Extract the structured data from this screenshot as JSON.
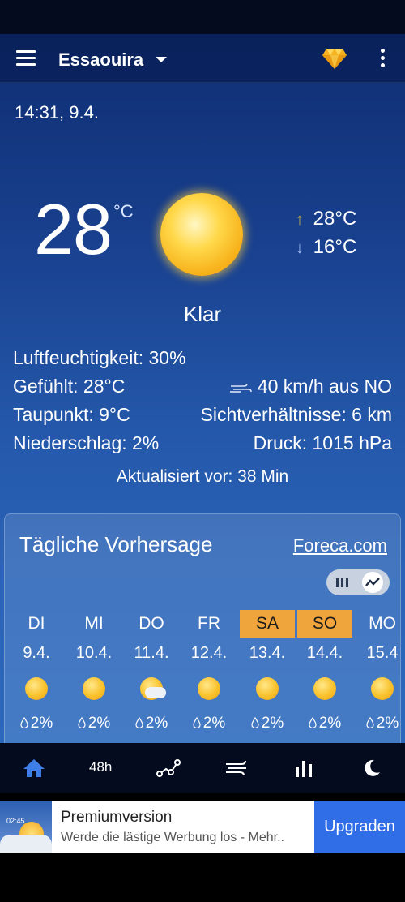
{
  "header": {
    "city": "Essaouira"
  },
  "current": {
    "timestamp": "14:31, 9.4.",
    "temperature": "28",
    "unit": "°C",
    "high": "28°C",
    "low": "16°C",
    "condition": "Klar",
    "humidity": "Luftfeuchtigkeit: 30%",
    "feels_like": "Gefühlt: 28°C",
    "wind": "40 km/h aus NO",
    "dew_point": "Taupunkt: 9°C",
    "visibility": "Sichtverhältnisse: 6 km",
    "precipitation": "Niederschlag: 2%",
    "pressure": "Druck: 1015 hPa",
    "updated": "Aktualisiert vor: 38 Min"
  },
  "forecast": {
    "title": "Tägliche Vorhersage",
    "link": "Foreca.com",
    "days": [
      {
        "name": "DI",
        "date": "9.4.",
        "icon": "sun-icon",
        "precip": "2%",
        "weekend": false
      },
      {
        "name": "MI",
        "date": "10.4.",
        "icon": "sun-icon",
        "precip": "2%",
        "weekend": false
      },
      {
        "name": "DO",
        "date": "11.4.",
        "icon": "partly-cloudy-icon",
        "precip": "2%",
        "weekend": false
      },
      {
        "name": "FR",
        "date": "12.4.",
        "icon": "sun-icon",
        "precip": "2%",
        "weekend": false
      },
      {
        "name": "SA",
        "date": "13.4.",
        "icon": "sun-icon",
        "precip": "2%",
        "weekend": true
      },
      {
        "name": "SO",
        "date": "14.4.",
        "icon": "sun-icon",
        "precip": "2%",
        "weekend": true
      },
      {
        "name": "MO",
        "date": "15.4",
        "icon": "sun-icon",
        "precip": "2%",
        "weekend": false
      }
    ]
  },
  "nav": {
    "hours_label": "48h"
  },
  "ad": {
    "thumb_time": "02:45",
    "title": "Premiumversion",
    "subtitle": "Werde die lästige Werbung los - Mehr..",
    "button": "Upgraden"
  },
  "colors": {
    "weekend_highlight": "#f0a43c",
    "ad_button": "#2f6ee6",
    "nav_bg": "#050b1f"
  }
}
